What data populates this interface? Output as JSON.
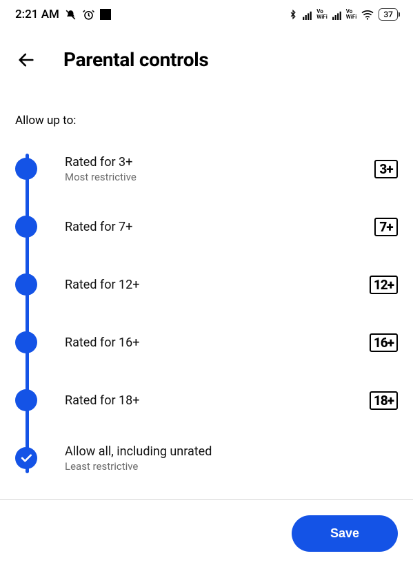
{
  "status": {
    "time": "2:21 AM",
    "battery": "37"
  },
  "header": {
    "title": "Parental controls"
  },
  "section_label": "Allow up to:",
  "options": [
    {
      "title": "Rated for 3+",
      "sub": "Most restrictive",
      "badge": "3+",
      "selected": false
    },
    {
      "title": "Rated for 7+",
      "sub": "",
      "badge": "7+",
      "selected": false
    },
    {
      "title": "Rated for 12+",
      "sub": "",
      "badge": "12+",
      "selected": false
    },
    {
      "title": "Rated for 16+",
      "sub": "",
      "badge": "16+",
      "selected": false
    },
    {
      "title": "Rated for 18+",
      "sub": "",
      "badge": "18+",
      "selected": false
    },
    {
      "title": "Allow all, including unrated",
      "sub": "Least restrictive",
      "badge": "",
      "selected": true
    }
  ],
  "footer": {
    "save_label": "Save"
  }
}
